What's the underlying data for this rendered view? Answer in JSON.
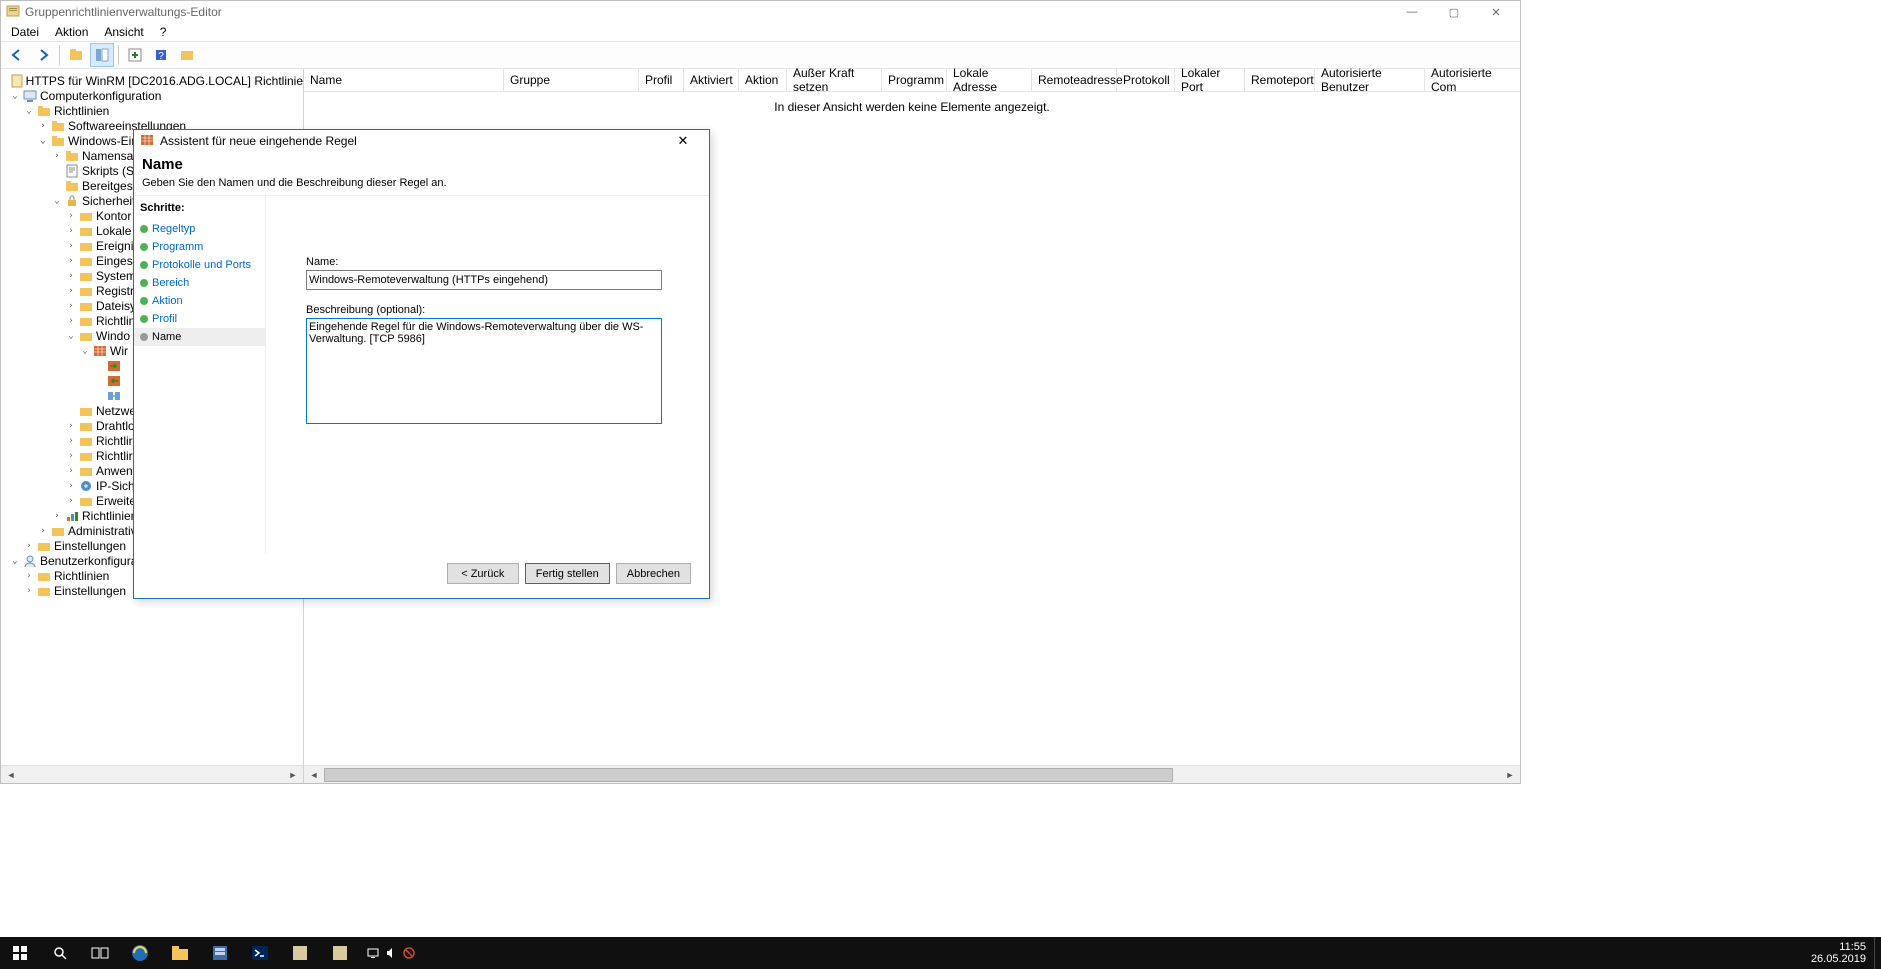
{
  "app": {
    "title": "Gruppenrichtlinienverwaltungs-Editor",
    "menus": [
      "Datei",
      "Aktion",
      "Ansicht",
      "?"
    ]
  },
  "tree": {
    "root_label": "HTTPS für WinRM [DC2016.ADG.LOCAL] Richtlinie",
    "computer_cfg": "Computerkonfiguration",
    "richtlinien": "Richtlinien",
    "software": "Softwareeinstellungen",
    "windows_eins": "Windows-Eins",
    "namensau": "Namensau",
    "skripts": "Skripts (Sta",
    "bereitgest": "Bereitgeste",
    "sicherheit": "Sicherheits",
    "kontor": "Kontor",
    "lokale": "Lokale",
    "ereignis": "Ereignis",
    "eingesc": "Eingesc",
    "system": "System",
    "registr": "Registr",
    "dateisy": "Dateisy",
    "richtlin": "Richtlin",
    "windo": "Windo",
    "wir": "Wir",
    "netzwe": "Netzwe",
    "drahtl": "Drahtlo",
    "richtlir2": "Richtlir",
    "richtlir3": "Richtlir",
    "anwen": "Anwen",
    "ipsich": "IP-Sich",
    "erweite": "Erweite",
    "richtlinien_admin": "Richtlinien",
    "admin": "Administrative",
    "einstellungen": "Einstellungen",
    "benutzercfg": "Benutzerkonfiguration",
    "user_richtlinien": "Richtlinien",
    "user_einstellungen": "Einstellungen"
  },
  "list": {
    "columns": [
      "Name",
      "Gruppe",
      "Profil",
      "Aktiviert",
      "Aktion",
      "Außer Kraft setzen",
      "Programm",
      "Lokale Adresse",
      "Remoteadresse",
      "Protokoll",
      "Lokaler Port",
      "Remoteport",
      "Autorisierte Benutzer",
      "Autorisierte Com"
    ],
    "empty_msg": "In dieser Ansicht werden keine Elemente angezeigt."
  },
  "wizard": {
    "title": "Assistent für neue eingehende Regel",
    "heading": "Name",
    "subheading": "Geben Sie den Namen und die Beschreibung dieser Regel an.",
    "steps_title": "Schritte:",
    "steps": [
      "Regeltyp",
      "Programm",
      "Protokolle und Ports",
      "Bereich",
      "Aktion",
      "Profil",
      "Name"
    ],
    "current_step": "Name",
    "name_label": "Name:",
    "name_value": "Windows-Remoteverwaltung (HTTPs eingehend)",
    "desc_label": "Beschreibung (optional):",
    "desc_value": "Eingehende Regel für die Windows-Remoteverwaltung über die WS-Verwaltung. [TCP 5986]",
    "btn_back": "< Zurück",
    "btn_finish": "Fertig stellen",
    "btn_cancel": "Abbrechen"
  },
  "taskbar": {
    "time": "11:55",
    "date": "26.05.2019"
  }
}
